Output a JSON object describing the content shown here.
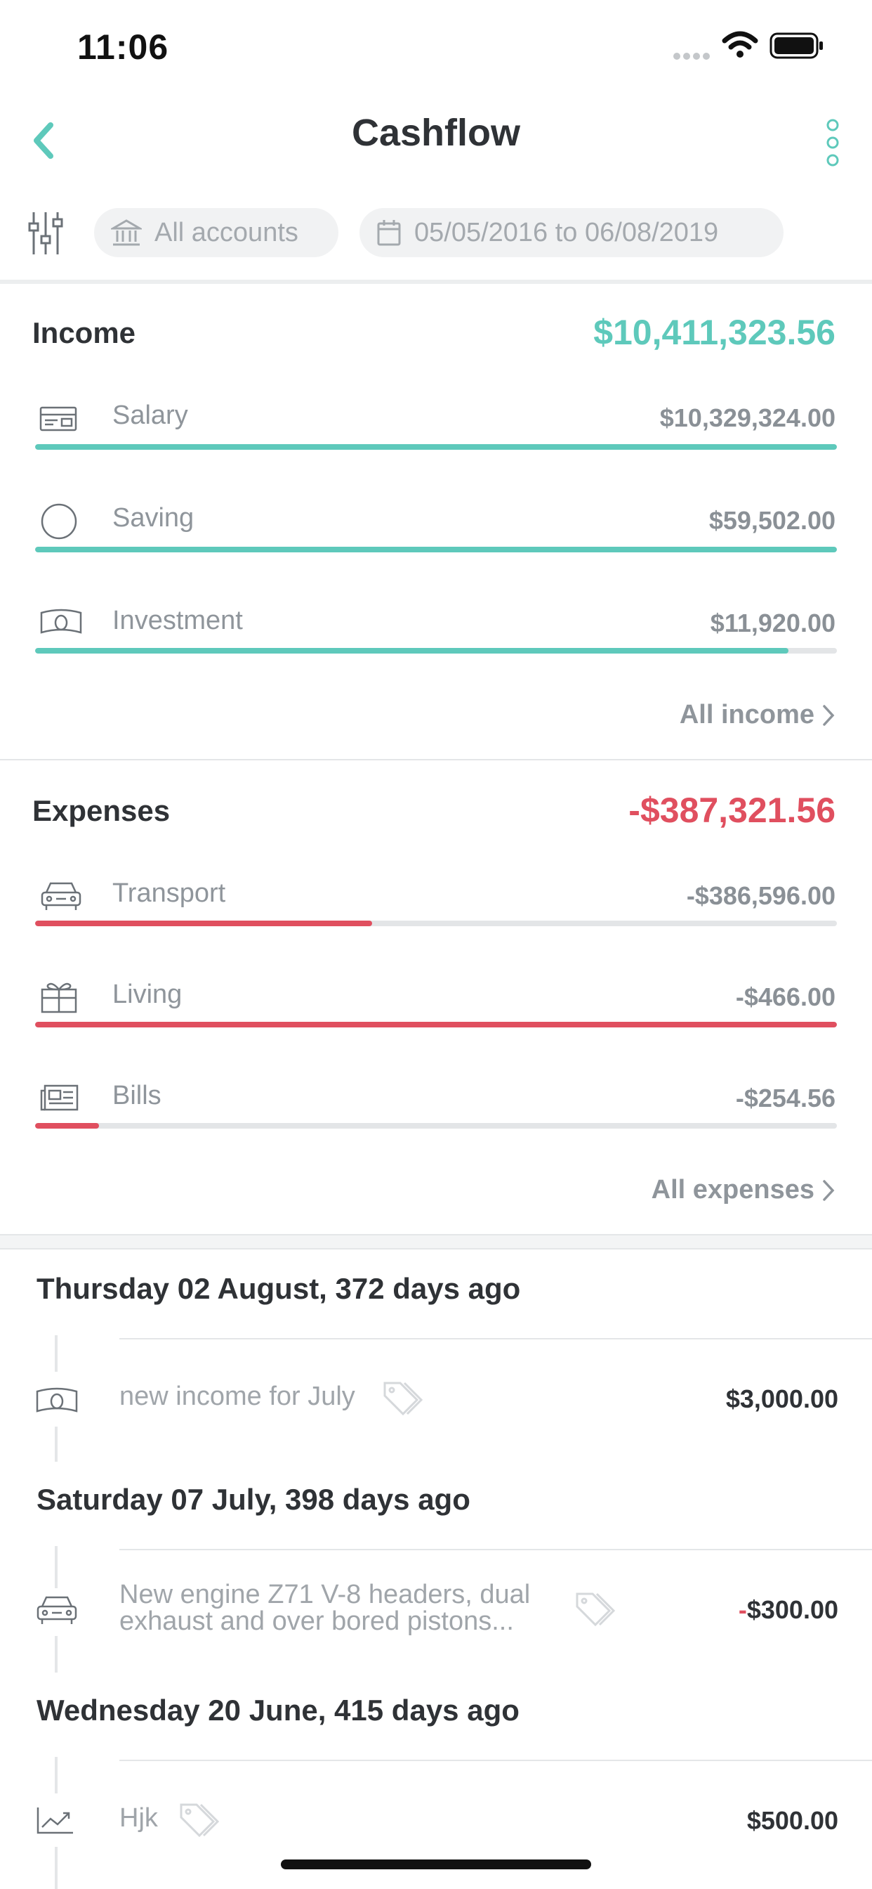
{
  "status_bar": {
    "time": "11:06"
  },
  "nav": {
    "title": "Cashflow"
  },
  "filters": {
    "accounts_label": "All accounts",
    "date_range": "05/05/2016 to 06/08/2019"
  },
  "colors": {
    "income": "#5ec9bb",
    "expense": "#e04f5f",
    "accent": "#5ec9bb"
  },
  "income": {
    "title": "Income",
    "total": "$10,411,323.56",
    "items": [
      {
        "label": "Salary",
        "amount": "$10,329,324.00",
        "icon": "card-icon",
        "fill_fraction": 1.0
      },
      {
        "label": "Saving",
        "amount": "$59,502.00",
        "icon": "circle-icon",
        "fill_fraction": 1.0
      },
      {
        "label": "Investment",
        "amount": "$11,920.00",
        "icon": "banknote-icon",
        "fill_fraction": 0.94
      }
    ],
    "link": "All income"
  },
  "expenses": {
    "title": "Expenses",
    "total": "-$387,321.56",
    "items": [
      {
        "label": "Transport",
        "amount": "-$386,596.00",
        "icon": "car-icon",
        "fill_fraction": 0.42
      },
      {
        "label": "Living",
        "amount": "-$466.00",
        "icon": "gift-icon",
        "fill_fraction": 1.0
      },
      {
        "label": "Bills",
        "amount": "-$254.56",
        "icon": "newspaper-icon",
        "fill_fraction": 0.08
      }
    ],
    "link": "All expenses"
  },
  "transactions": [
    {
      "day": "Thursday 02 August, 372 days ago",
      "description": "new income for July",
      "amount": "$3,000.00",
      "icon": "banknote-icon"
    },
    {
      "day": "Saturday 07 July, 398 days ago",
      "description_line1": "New engine  Z71 V-8  headers, dual",
      "description_line2": "exhaust and over bored pistons...",
      "amount_sign": "-",
      "amount": "$300.00",
      "icon": "car-icon"
    },
    {
      "day": "Wednesday 20 June, 415 days ago",
      "description": "Hjk",
      "amount": "$500.00",
      "icon": "trend-up-icon"
    }
  ]
}
